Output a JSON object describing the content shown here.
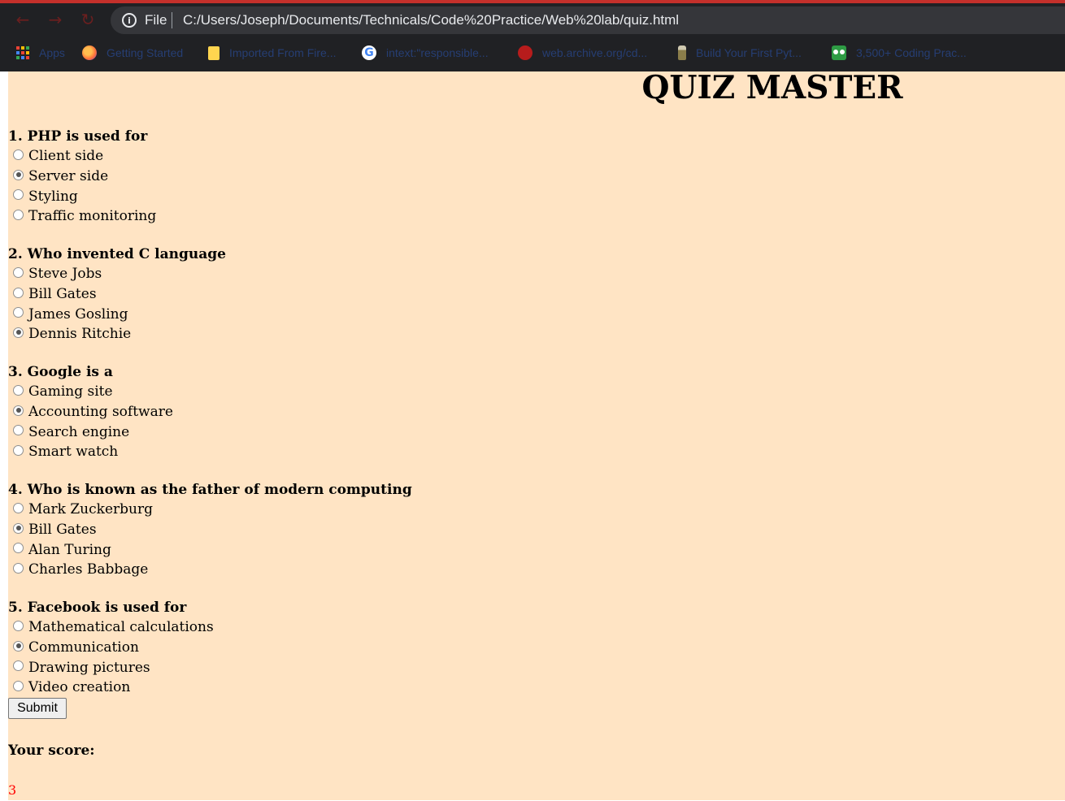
{
  "browser": {
    "scheme_label": "File",
    "url": "C:/Users/Joseph/Documents/Technicals/Code%20Practice/Web%20lab/quiz.html",
    "bookmarks": [
      {
        "label": "Apps",
        "icon": "apps-icon"
      },
      {
        "label": "Getting Started",
        "icon": "firefox-icon"
      },
      {
        "label": "Imported From Fire...",
        "icon": "folder-icon"
      },
      {
        "label": "intext:\"responsible...",
        "icon": "google-icon"
      },
      {
        "label": "web.archive.org/cd...",
        "icon": "archive-icon"
      },
      {
        "label": "Build Your First Pyt...",
        "icon": "bottle-icon"
      },
      {
        "label": "3,500+ Coding Prac...",
        "icon": "owl-icon"
      }
    ]
  },
  "page": {
    "title": "QUIZ MASTER",
    "questions": [
      {
        "text": "1. PHP is used for",
        "options": [
          "Client side",
          "Server side",
          "Styling",
          "Traffic monitoring"
        ],
        "selected": 1
      },
      {
        "text": "2. Who invented C language",
        "options": [
          "Steve Jobs",
          "Bill Gates",
          "James Gosling",
          "Dennis Ritchie"
        ],
        "selected": 3
      },
      {
        "text": "3. Google is a",
        "options": [
          "Gaming site",
          "Accounting software",
          "Search engine",
          "Smart watch"
        ],
        "selected": 1
      },
      {
        "text": "4. Who is known as the father of modern computing",
        "options": [
          "Mark Zuckerburg",
          "Bill Gates",
          "Alan Turing",
          "Charles Babbage"
        ],
        "selected": 1
      },
      {
        "text": "5. Facebook is used for",
        "options": [
          "Mathematical calculations",
          "Communication",
          "Drawing pictures",
          "Video creation"
        ],
        "selected": 1
      }
    ],
    "submit_label": "Submit",
    "score_label": "Your score:",
    "score_value": "3",
    "score_color": "#ff0000",
    "background_color": "#ffe4c4"
  }
}
